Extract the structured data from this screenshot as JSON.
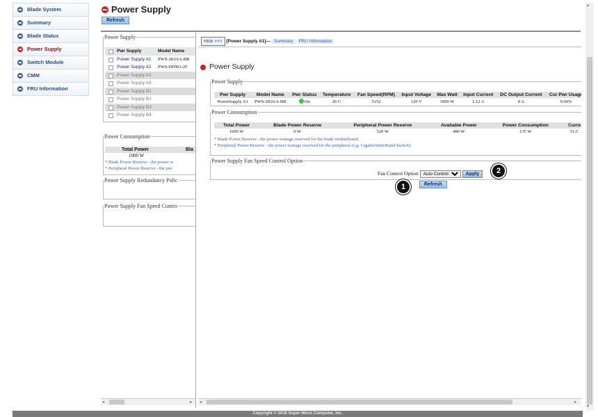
{
  "nav": {
    "items": [
      {
        "label": "Blade System",
        "active": false
      },
      {
        "label": "Summary",
        "active": false
      },
      {
        "label": "Blade Status",
        "active": false
      },
      {
        "label": "Power Supply",
        "active": true
      },
      {
        "label": "Switch Module",
        "active": false
      },
      {
        "label": "CMM",
        "active": false
      },
      {
        "label": "FRU Information",
        "active": false
      }
    ]
  },
  "header": {
    "title": "Power Supply",
    "refresh_label": "Refresh"
  },
  "left_panel": {
    "power_supply_legend": "Power Supply",
    "col_pwr_supply": "Pwr Supply",
    "col_model_name": "Model Name",
    "supplies": [
      {
        "name": "Power Supply A1",
        "model": "PWS-2K01A-BR",
        "available": true
      },
      {
        "name": "Power Supply A2",
        "model": "PWS-DF003-2F",
        "available": true
      },
      {
        "name": "Power Supply A3",
        "model": "",
        "available": false
      },
      {
        "name": "Power Supply A4",
        "model": "",
        "available": false
      },
      {
        "name": "Power Supply B1",
        "model": "",
        "available": false
      },
      {
        "name": "Power Supply B2",
        "model": "",
        "available": false
      },
      {
        "name": "Power Supply B3",
        "model": "",
        "available": false
      },
      {
        "name": "Power Supply B4",
        "model": "",
        "available": false
      }
    ],
    "consumption_legend": "Power Consumption",
    "col_total_power": "Total Power",
    "col_blade_partial": "Bla",
    "total_power": "1000 W",
    "note_blade": "* Blade Power Reserve - the power w",
    "note_peripheral": "* Peripheral Power Reserve - the pov",
    "redundancy_legend": "Power Supply Redundancy Polic",
    "fan_legend": "Power Supply Fan Speed Contro"
  },
  "right_panel": {
    "hide_label": "Hide >>>",
    "current_tab": "[Power Supply A1]—",
    "tab_summary": "Summary",
    "tab_fru": "FRU Information",
    "title": "Power Supply",
    "supply_legend": "Power Supply",
    "supply_headers": [
      "Pwr Supply",
      "Model Name",
      "Pwr Status",
      "Temperature",
      "Fan Speed(RPM)",
      "Input Voltage",
      "Max Watt",
      "Input Current",
      "DC Output Current",
      "Cur Pwr Usage"
    ],
    "supply_row": {
      "name": "PowerSupply A1",
      "model": "PWS-2K01A-BR",
      "status": "On",
      "temperature": "26 C",
      "fan_speed": "5152",
      "input_voltage": "120 V",
      "max_watt": "1000 W",
      "input_current": "1.12 A",
      "dc_output_current": "8 A",
      "cur_pwr_usage": "9.60%"
    },
    "consumption_legend": "Power Consumption",
    "consumption_headers": [
      "Total Power",
      "Blade Power Reserve",
      "Peripheral Power Reserve",
      "Available Power",
      "Power Consumption",
      "Curre"
    ],
    "consumption_row": [
      "1000 W",
      "0 W",
      "520 W",
      "480 W",
      "135 W",
      "51.C"
    ],
    "note_blade": "* Blade Power Reserve - the power wattage reserved for the blade motherboard.",
    "note_peripheral": "* Peripheral Power Reserve - the power wattage reserved for the peripheral (e.g. Gigabit/InfiniBand Switch).",
    "fan_legend": "Power Supply Fan Speed Control Option",
    "fan_label": "Fan Control Option",
    "fan_value": "Auto Control",
    "apply_label": "Apply",
    "refresh_label": "Refresh"
  },
  "callouts": {
    "one": "1",
    "two": "2"
  },
  "footer": {
    "copyright": "Copyright © 2016 Super Micro Computer, Inc."
  }
}
